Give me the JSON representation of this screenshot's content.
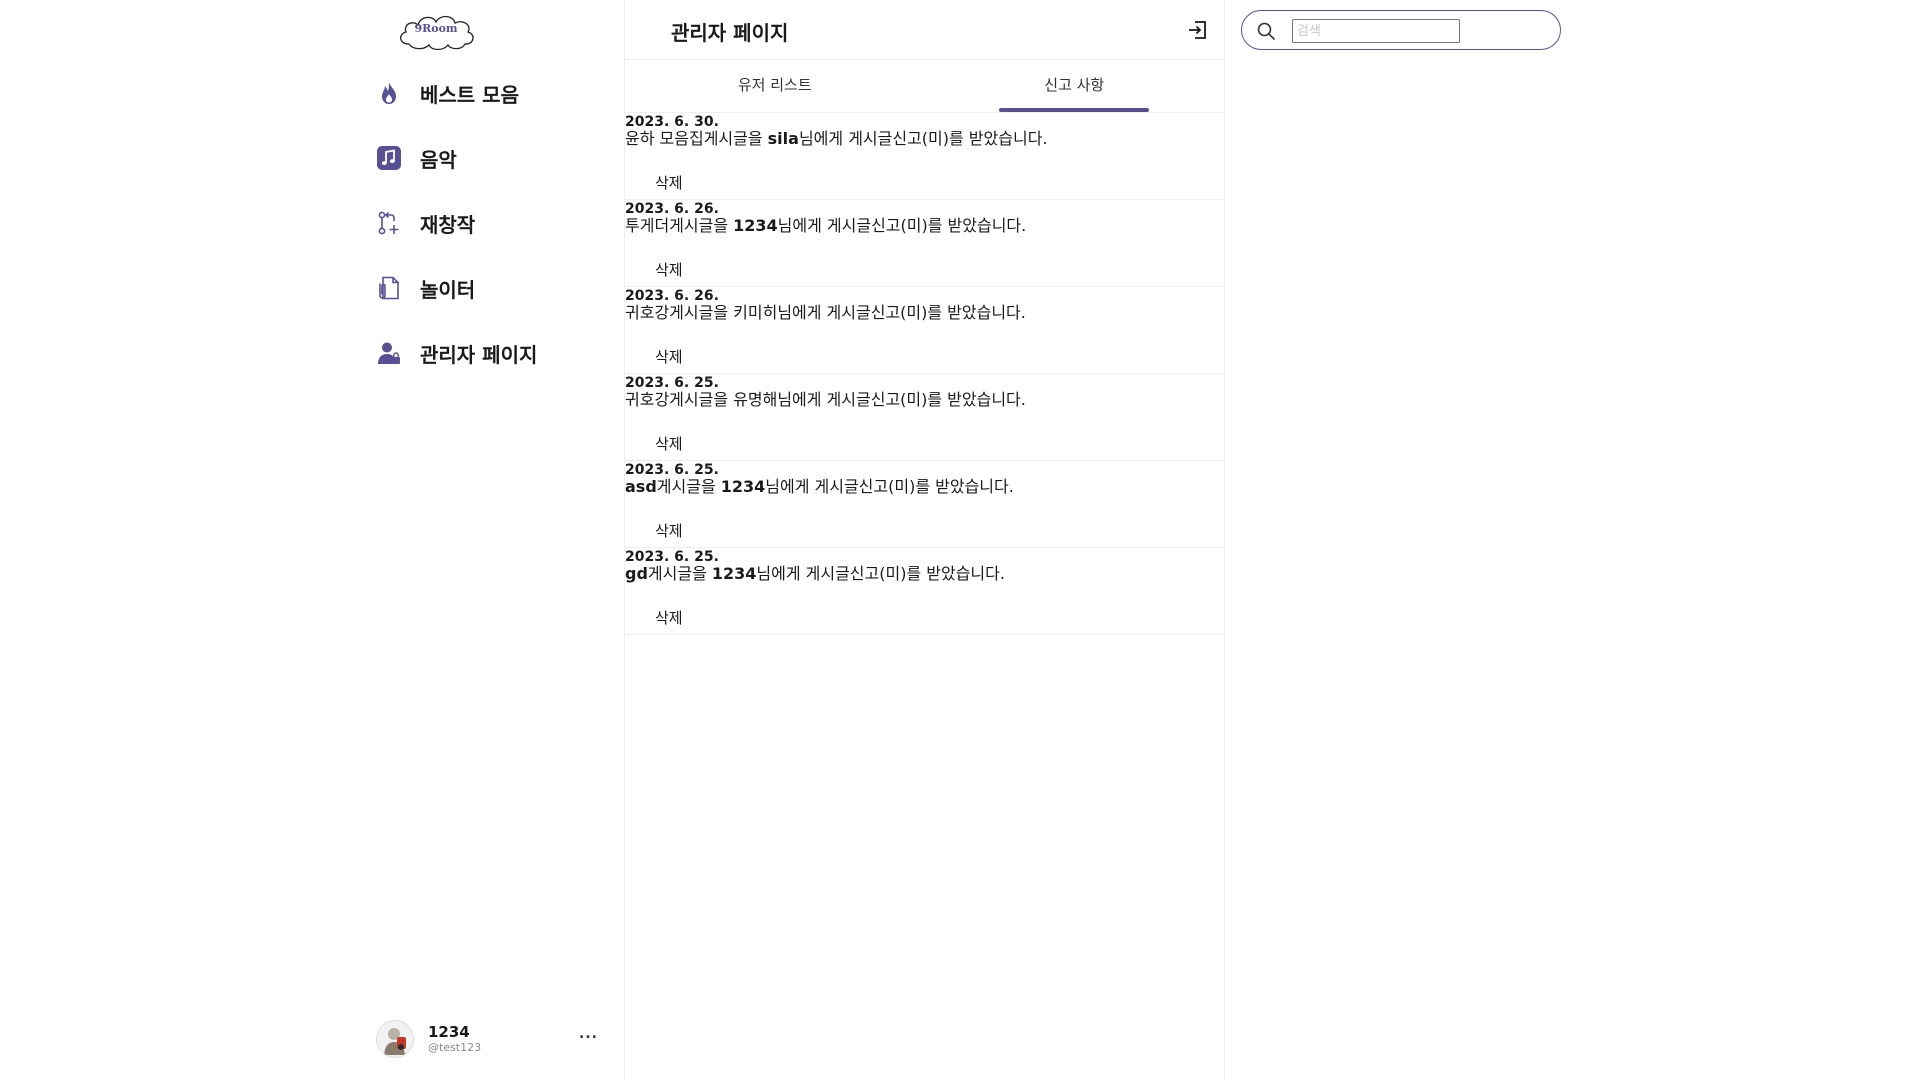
{
  "app": {
    "logo_text": "9Room",
    "brand_color": "#575194"
  },
  "sidebar": {
    "items": [
      {
        "label": "베스트 모음",
        "icon": "flame-icon"
      },
      {
        "label": "음악",
        "icon": "music-note-icon"
      },
      {
        "label": "재창작",
        "icon": "git-pull-request-icon"
      },
      {
        "label": "놀이터",
        "icon": "document-clip-icon"
      },
      {
        "label": "관리자 페이지",
        "icon": "admin-user-icon"
      }
    ]
  },
  "profile": {
    "name": "1234",
    "handle": "@test123",
    "more_label": "..."
  },
  "main": {
    "title": "관리자 페이지",
    "tabs": [
      {
        "label": "유저 리스트",
        "active": false
      },
      {
        "label": "신고 사항",
        "active": true
      }
    ],
    "delete_label": "삭제",
    "reports": [
      {
        "date": "2023. 6. 30.",
        "title": "윤하 모음집",
        "user": "sila",
        "suffix_pre": "게시글을 ",
        "suffix_post": "님에게 게시글신고(미)를 받았습니다."
      },
      {
        "date": "2023. 6. 26.",
        "title": "투게더",
        "user": "1234",
        "suffix_pre": "게시글을 ",
        "suffix_post": "님에게 게시글신고(미)를 받았습니다."
      },
      {
        "date": "2023. 6. 26.",
        "title": "귀호강",
        "user": "키미히",
        "suffix_pre": "게시글을 ",
        "suffix_post": "님에게 게시글신고(미)를 받았습니다."
      },
      {
        "date": "2023. 6. 25.",
        "title": "귀호강",
        "user": "유명해",
        "suffix_pre": "게시글을 ",
        "suffix_post": "님에게 게시글신고(미)를 받았습니다."
      },
      {
        "date": "2023. 6. 25.",
        "title": "asd",
        "user": "1234",
        "suffix_pre": "게시글을 ",
        "suffix_post": "님에게 게시글신고(미)를 받았습니다."
      },
      {
        "date": "2023. 6. 25.",
        "title": "gd",
        "user": "1234",
        "suffix_pre": "게시글을 ",
        "suffix_post": "님에게 게시글신고(미)를 받았습니다."
      }
    ]
  },
  "search": {
    "placeholder": "검색",
    "value": ""
  }
}
